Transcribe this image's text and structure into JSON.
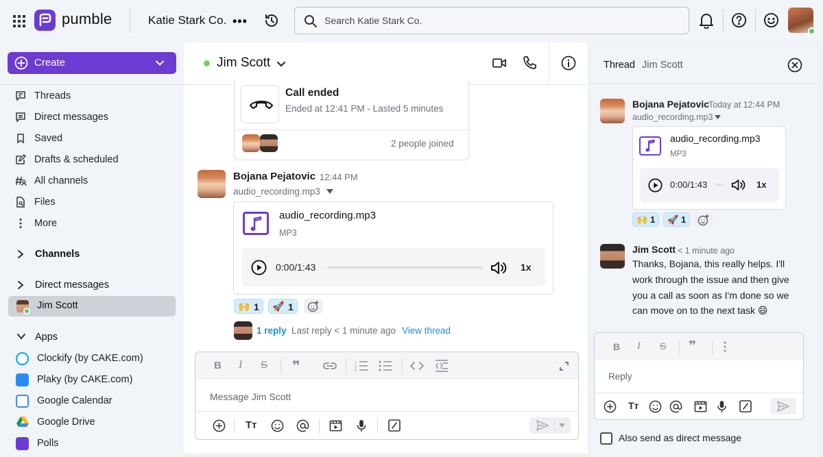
{
  "topbar": {
    "brand": "pumble",
    "workspace": "Katie Stark Co.",
    "workspace_more": "•••",
    "search_placeholder": "Search Katie Stark Co."
  },
  "sidebar": {
    "create_label": "Create",
    "nav": [
      {
        "label": "Threads",
        "icon": "threads-icon"
      },
      {
        "label": "Direct messages",
        "icon": "direct-messages-icon"
      },
      {
        "label": "Saved",
        "icon": "bookmark-icon"
      },
      {
        "label": "Drafts & scheduled",
        "icon": "drafts-icon"
      },
      {
        "label": "All channels",
        "icon": "channels-icon"
      },
      {
        "label": "Files",
        "icon": "files-icon"
      },
      {
        "label": "More",
        "icon": "more-vertical-icon"
      }
    ],
    "channels_label": "Channels",
    "dms_label": "Direct messages",
    "active_dm": "Jim Scott",
    "apps_label": "Apps",
    "apps": [
      {
        "label": "Clockify (by CAKE.com)",
        "color": "#2196f3"
      },
      {
        "label": "Plaky (by CAKE.com)",
        "color": "#2b8cf0"
      },
      {
        "label": "Google Calendar",
        "color": "#4285f4"
      },
      {
        "label": "Google Drive",
        "color": "#0f9d58"
      },
      {
        "label": "Polls",
        "color": "#6c3bd1"
      }
    ]
  },
  "channel": {
    "name": "Jim Scott",
    "call": {
      "title": "Call ended",
      "detail": "Ended at 12:41 PM - Lasted 5 minutes",
      "joined": "2 people joined"
    },
    "message": {
      "author": "Bojana Pejatovic",
      "time": "12:44 PM",
      "attachment_name": "audio_recording.mp3",
      "file_title": "audio_recording.mp3",
      "file_type": "MP3",
      "time_display": "0:00/1:43",
      "speed": "1x",
      "reactions": [
        {
          "emoji": "🙌",
          "count": "1"
        },
        {
          "emoji": "🚀",
          "count": "1"
        }
      ],
      "reply_count": "1 reply",
      "last_reply": "Last reply < 1 minute ago",
      "view_thread": "View thread"
    },
    "composer_placeholder": "Message Jim Scott"
  },
  "thread": {
    "title": "Thread",
    "subtitle": "Jim Scott",
    "root": {
      "author": "Bojana Pejatovic",
      "time": "Today at 12:44 PM",
      "attachment_name": "audio_recording.mp3",
      "file_title": "audio_recording.mp3",
      "file_type": "MP3",
      "time_display": "0:00/1:43",
      "speed": "1x",
      "reactions": [
        {
          "emoji": "🙌",
          "count": "1"
        },
        {
          "emoji": "🚀",
          "count": "1"
        }
      ]
    },
    "reply": {
      "author": "Jim Scott",
      "time": "< 1 minute ago",
      "lines": [
        "Thanks, Bojana, this really helps. I'll",
        "work through the issue and then give",
        "you a call as soon as I'm done so we",
        "can move on to the next task 😄"
      ]
    },
    "composer_placeholder": "Reply",
    "also_send_label": "Also send as direct message"
  },
  "colors": {
    "brand_purple": "#6c3bd1",
    "online_green": "#5cc65c",
    "link_blue": "#1a8ed8"
  }
}
